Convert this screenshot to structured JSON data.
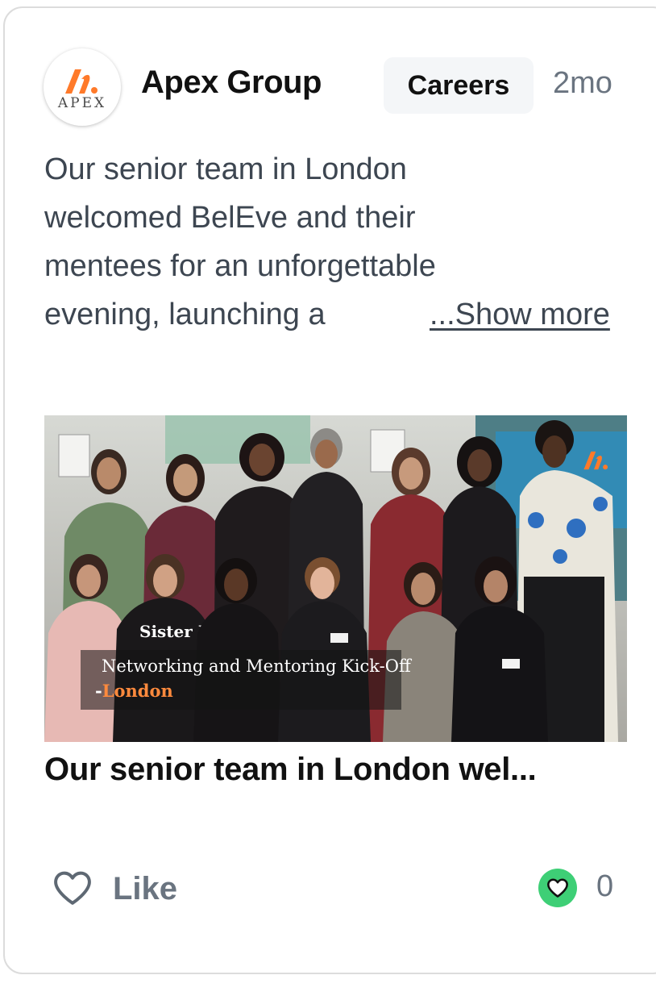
{
  "post": {
    "company": "Apex Group",
    "logo_text": "APEX",
    "tag": "Careers",
    "time": "2mo",
    "body_lines": [
      "Our senior team in London",
      "welcomed BelEve and their",
      "mentees for an unforgettable",
      "evening, launching a"
    ],
    "show_more": "...Show more",
    "image": {
      "caption_line1": "Networking and Mentoring Kick-Off",
      "caption_dash": "-",
      "caption_line2": "London",
      "shirt_text": "Sister Hood"
    },
    "title": "Our senior team in London wel...",
    "like_label": "Like",
    "like_count": "0"
  },
  "colors": {
    "brand_orange": "#ff7a2a",
    "like_green": "#3ecf76",
    "muted_text": "#6a7480"
  }
}
